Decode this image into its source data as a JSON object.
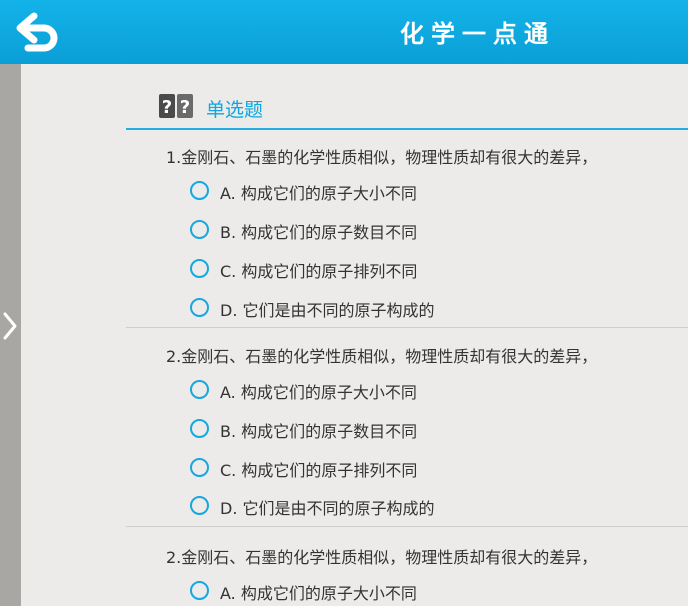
{
  "header": {
    "title": "化学一点通"
  },
  "section": {
    "title": "单选题"
  },
  "questions": [
    {
      "text": "1.金刚石、石墨的化学性质相似，物理性质却有很大的差异，",
      "options": [
        "A. 构成它们的原子大小不同",
        "B. 构成它们的原子数目不同",
        "C. 构成它们的原子排列不同",
        "D. 它们是由不同的原子构成的"
      ]
    },
    {
      "text": "2.金刚石、石墨的化学性质相似，物理性质却有很大的差异，",
      "options": [
        "A. 构成它们的原子大小不同",
        "B. 构成它们的原子数目不同",
        "C. 构成它们的原子排列不同",
        "D. 它们是由不同的原子构成的"
      ]
    },
    {
      "text": "2.金刚石、石墨的化学性质相似，物理性质却有很大的差异，",
      "options": [
        "A. 构成它们的原子大小不同"
      ]
    }
  ],
  "colors": {
    "header": "#0ea7df",
    "accent": "#15a7e0",
    "background": "#ecebea",
    "side_strip": "#a8a7a4"
  },
  "icons": {
    "back": "back-arrow-icon",
    "side": "chevron-right-icon",
    "section": "question-box-icon",
    "option": "radio-circle-icon"
  }
}
